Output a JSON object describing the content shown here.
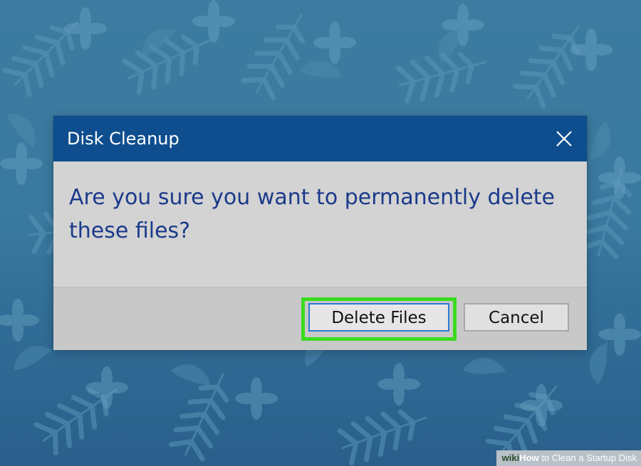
{
  "dialog": {
    "title": "Disk Cleanup",
    "message": "Are you sure you want to permanently delete these files?",
    "buttons": {
      "delete_label": "Delete Files",
      "cancel_label": "Cancel"
    },
    "close_icon": "close-icon",
    "highlighted_button": "Delete Files"
  },
  "watermark": {
    "brand": "wiki",
    "how": "How",
    "text": "to Clean a Startup Disk"
  },
  "colors": {
    "title_bar": "#0e4e8e",
    "message_text": "#1a3a8a",
    "highlight": "#3bdb1f",
    "focus_border": "#2a7ad6",
    "desktop": "#3a7aa0"
  }
}
